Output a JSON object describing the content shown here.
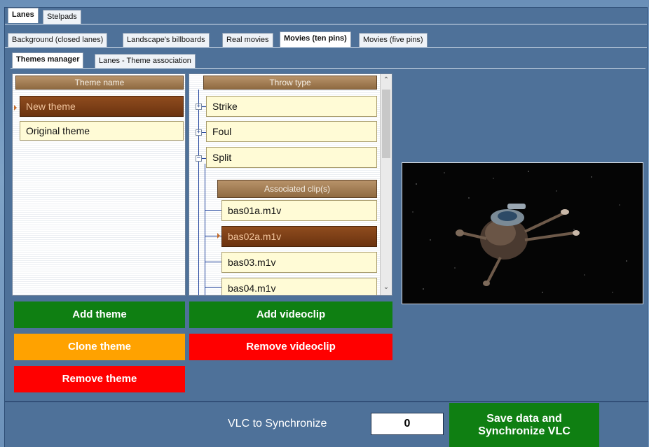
{
  "tabs_l1": [
    {
      "label": "Lanes"
    },
    {
      "label": "Stelpads"
    }
  ],
  "tabs_l2": [
    {
      "label": "Background (closed lanes)"
    },
    {
      "label": "Landscape's billboards"
    },
    {
      "label": "Real movies"
    },
    {
      "label": "Movies (ten pins)"
    },
    {
      "label": "Movies (five pins)"
    }
  ],
  "tabs_l3": [
    {
      "label": "Themes manager"
    },
    {
      "label": "Lanes - Theme association"
    }
  ],
  "themes": {
    "header": "Theme name",
    "items": [
      {
        "label": "New theme",
        "selected": true
      },
      {
        "label": "Original theme",
        "selected": false
      }
    ]
  },
  "throws": {
    "header": "Throw type",
    "items": [
      {
        "label": "Strike",
        "expander": "+"
      },
      {
        "label": "Foul",
        "expander": "+"
      },
      {
        "label": "Split",
        "expander": "−"
      }
    ],
    "clips_header": "Associated clip(s)",
    "clips": [
      {
        "label": "bas01a.m1v",
        "selected": false
      },
      {
        "label": "bas02a.m1v",
        "selected": true
      },
      {
        "label": "bas03.m1v",
        "selected": false
      },
      {
        "label": "bas04.m1v",
        "selected": false
      }
    ]
  },
  "buttons": {
    "add_theme": "Add theme",
    "clone_theme": "Clone theme",
    "remove_theme": "Remove theme",
    "add_videoclip": "Add videoclip",
    "remove_videoclip": "Remove videoclip",
    "save_sync_line1": "Save data and",
    "save_sync_line2": "Synchronize VLC"
  },
  "sync": {
    "label": "VLC to Synchronize",
    "value": "0"
  },
  "colors": {
    "green": "#0f7f12",
    "orange": "#ffa200",
    "red": "#ff0000",
    "header_brown": "#8f6a41",
    "selected_brown": "#7a3a12"
  },
  "icons": {
    "expand": "plus-box-icon",
    "collapse": "minus-box-icon",
    "row_marker": "triangle-right-icon"
  }
}
